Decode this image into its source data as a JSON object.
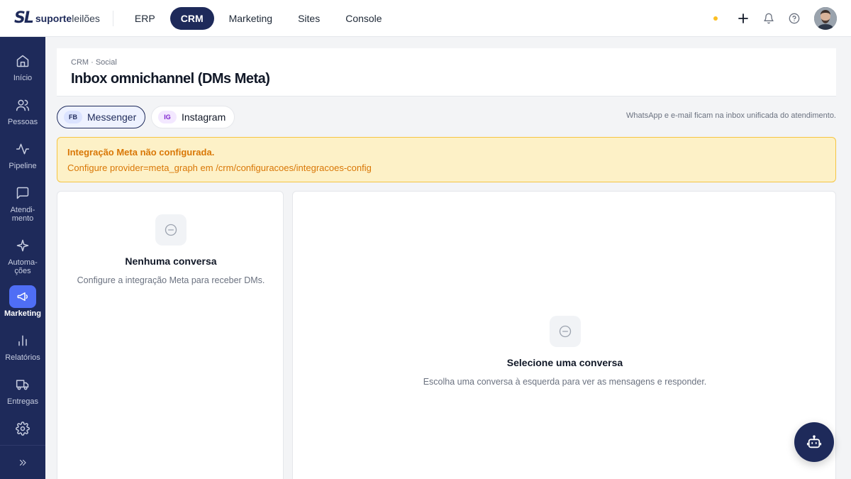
{
  "brand": {
    "mark": "SL",
    "name_bold": "suporte",
    "name_light": "leilões"
  },
  "topnav": {
    "items": [
      {
        "label": "ERP",
        "active": false
      },
      {
        "label": "CRM",
        "active": true
      },
      {
        "label": "Marketing",
        "active": false
      },
      {
        "label": "Sites",
        "active": false
      },
      {
        "label": "Console",
        "active": false
      }
    ]
  },
  "topbar_icons": [
    "status-dot",
    "plus-icon",
    "bell-icon",
    "help-icon",
    "user-avatar"
  ],
  "sidebar": {
    "items": [
      {
        "label": "Início",
        "icon": "home-icon"
      },
      {
        "label": "Pessoas",
        "icon": "users-icon"
      },
      {
        "label": "Pipeline",
        "icon": "activity-icon"
      },
      {
        "label": "Atendi-\nmento",
        "icon": "chat-icon"
      },
      {
        "label": "Automa-\nções",
        "icon": "sparkle-icon"
      },
      {
        "label": "Marketing",
        "icon": "megaphone-icon",
        "active": true
      },
      {
        "label": "Relatórios",
        "icon": "bar-chart-icon"
      },
      {
        "label": "Entregas",
        "icon": "truck-icon"
      },
      {
        "label": "",
        "icon": "settings-icon"
      }
    ],
    "expand_icon": "chevrons-right-icon"
  },
  "header": {
    "breadcrumb": "CRM · Social",
    "title": "Inbox omnichannel (DMs Meta)"
  },
  "channels": [
    {
      "badge": "FB",
      "label": "Messenger",
      "active": true
    },
    {
      "badge": "IG",
      "label": "Instagram",
      "active": false
    }
  ],
  "channels_note": "WhatsApp e e-mail ficam na inbox unificada do atendimento.",
  "alert": {
    "title": "Integração Meta não configurada.",
    "body": "Configure provider=meta_graph em /crm/configuracoes/integracoes-config"
  },
  "left_panel": {
    "title": "Nenhuma conversa",
    "subtitle": "Configure a integração Meta para receber DMs."
  },
  "right_panel": {
    "title": "Selecione uma conversa",
    "subtitle": "Escolha uma conversa à esquerda para ver as mensagens e responder."
  },
  "colors": {
    "navy": "#1e2a5a",
    "accent": "#4f6ef5",
    "warning_bg": "#fdf1c7",
    "warning_text": "#d97706"
  }
}
